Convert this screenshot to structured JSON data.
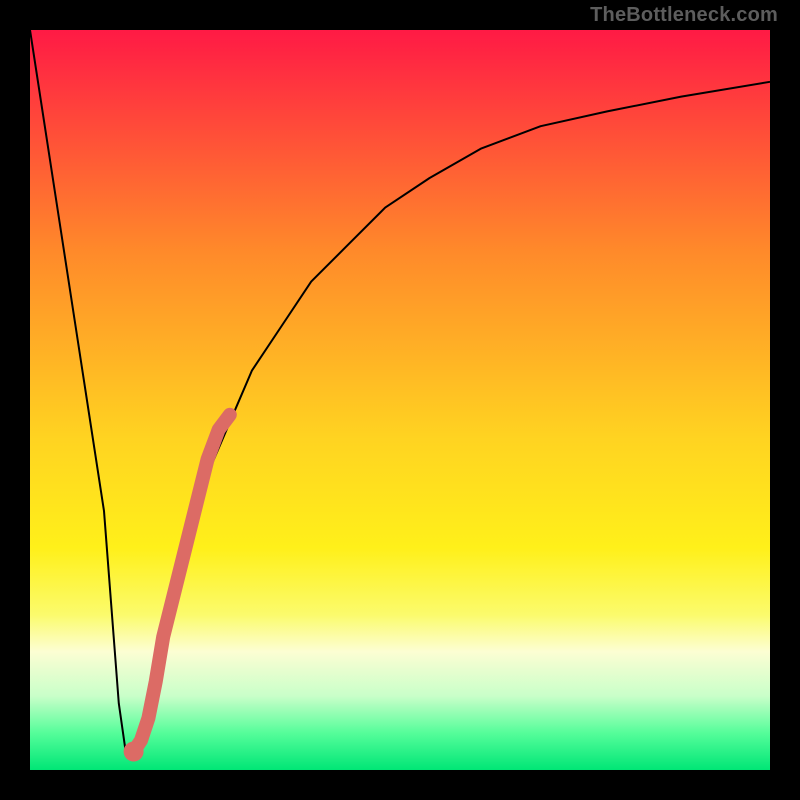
{
  "watermark": {
    "text": "TheBottleneck.com"
  },
  "colors": {
    "frame": "#000000",
    "gradient_stops": [
      {
        "pct": 0,
        "color": "#ff1a45"
      },
      {
        "pct": 30,
        "color": "#ff8a2a"
      },
      {
        "pct": 55,
        "color": "#ffd321"
      },
      {
        "pct": 70,
        "color": "#fff01a"
      },
      {
        "pct": 79,
        "color": "#fbfb6c"
      },
      {
        "pct": 84,
        "color": "#fcfed3"
      },
      {
        "pct": 90,
        "color": "#c9ffc9"
      },
      {
        "pct": 95,
        "color": "#55fd9a"
      },
      {
        "pct": 100,
        "color": "#00e676"
      }
    ],
    "curve": "#000000",
    "highlight": "#dc6b65"
  },
  "chart_data": {
    "type": "line",
    "title": "",
    "xlabel": "",
    "ylabel": "",
    "xlim": [
      0,
      100
    ],
    "ylim": [
      0,
      100
    ],
    "grid": false,
    "series": [
      {
        "name": "bottleneck-curve",
        "x": [
          0,
          2,
          4,
          6,
          8,
          10,
          11,
          12,
          13,
          14,
          16,
          18,
          20,
          22,
          24,
          27,
          30,
          34,
          38,
          43,
          48,
          54,
          61,
          69,
          78,
          88,
          100
        ],
        "values": [
          100,
          87,
          74,
          61,
          48,
          35,
          22,
          9,
          2,
          3,
          9,
          16,
          24,
          32,
          40,
          47,
          54,
          60,
          66,
          71,
          76,
          80,
          84,
          87,
          89,
          91,
          93
        ]
      },
      {
        "name": "highlight-segment",
        "x": [
          14.0,
          15.0,
          16.0,
          17.0,
          18.0,
          19.5,
          21.0,
          22.5,
          24.0,
          25.5,
          27.0
        ],
        "values": [
          2.5,
          4.0,
          7.0,
          12.0,
          18.0,
          24.0,
          30.0,
          36.0,
          42.0,
          46.0,
          48.0
        ]
      }
    ],
    "annotations": [
      {
        "name": "highlight-dot",
        "x": 14.0,
        "y": 2.5
      }
    ]
  }
}
